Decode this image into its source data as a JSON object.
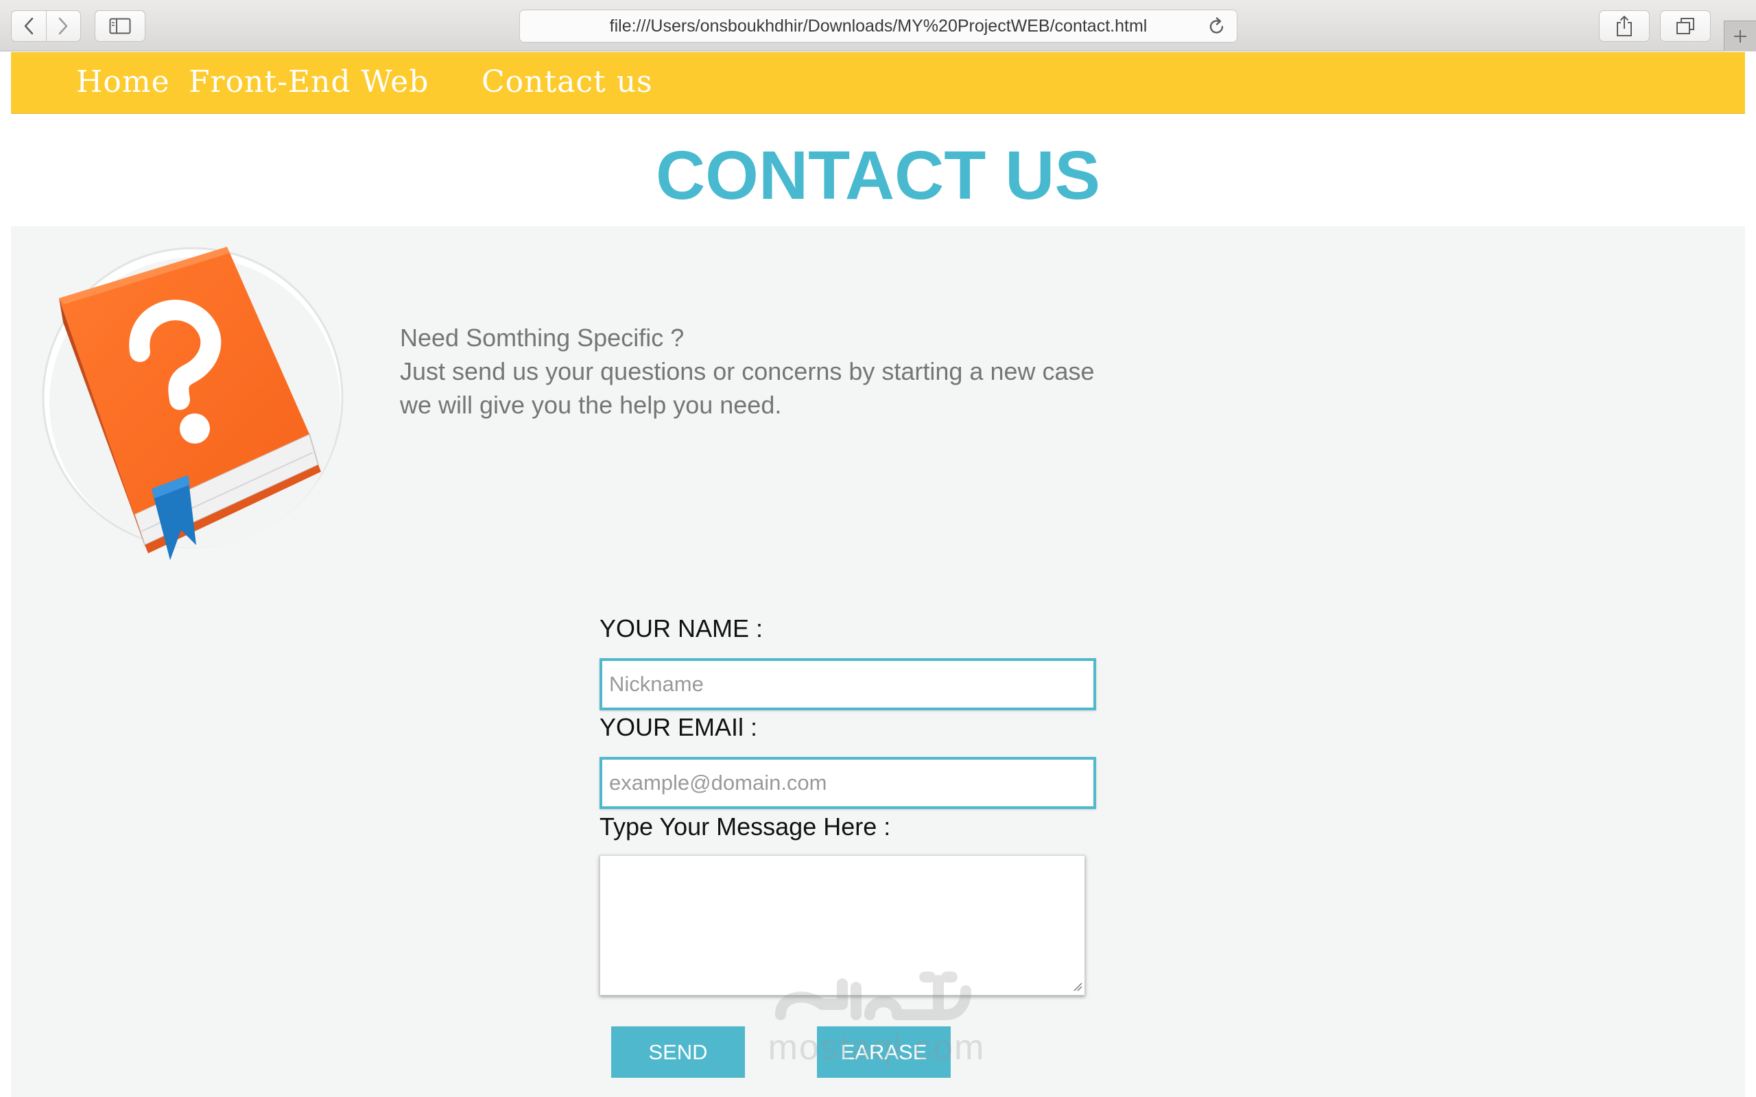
{
  "browser": {
    "url": "file:///Users/onsboukhdhir/Downloads/MY%20ProjectWEB/contact.html"
  },
  "nav": {
    "links": [
      "Home",
      "Front-End Web",
      "Contact us"
    ],
    "background_color": "#fdcb2e"
  },
  "page": {
    "title": "CONTACT US",
    "accent_color": "#48b9cf"
  },
  "intro": {
    "lines": [
      "Need Somthing Specific ?",
      "Just send us your questions or concerns by starting a new case",
      "we will give you the help you need."
    ]
  },
  "illustration": {
    "icon": "question-book-icon"
  },
  "form": {
    "name_label": "YOUR NAME :",
    "name_placeholder": "Nickname",
    "email_label": "YOUR EMAIl :",
    "email_placeholder": "example@domain.com",
    "message_label": "Type Your Message Here :",
    "send_label": "SEND",
    "erase_label": "EARASE",
    "button_color": "#4fb8cd"
  },
  "watermark": {
    "text": "مستقل",
    "latin": "mostaql.com"
  }
}
